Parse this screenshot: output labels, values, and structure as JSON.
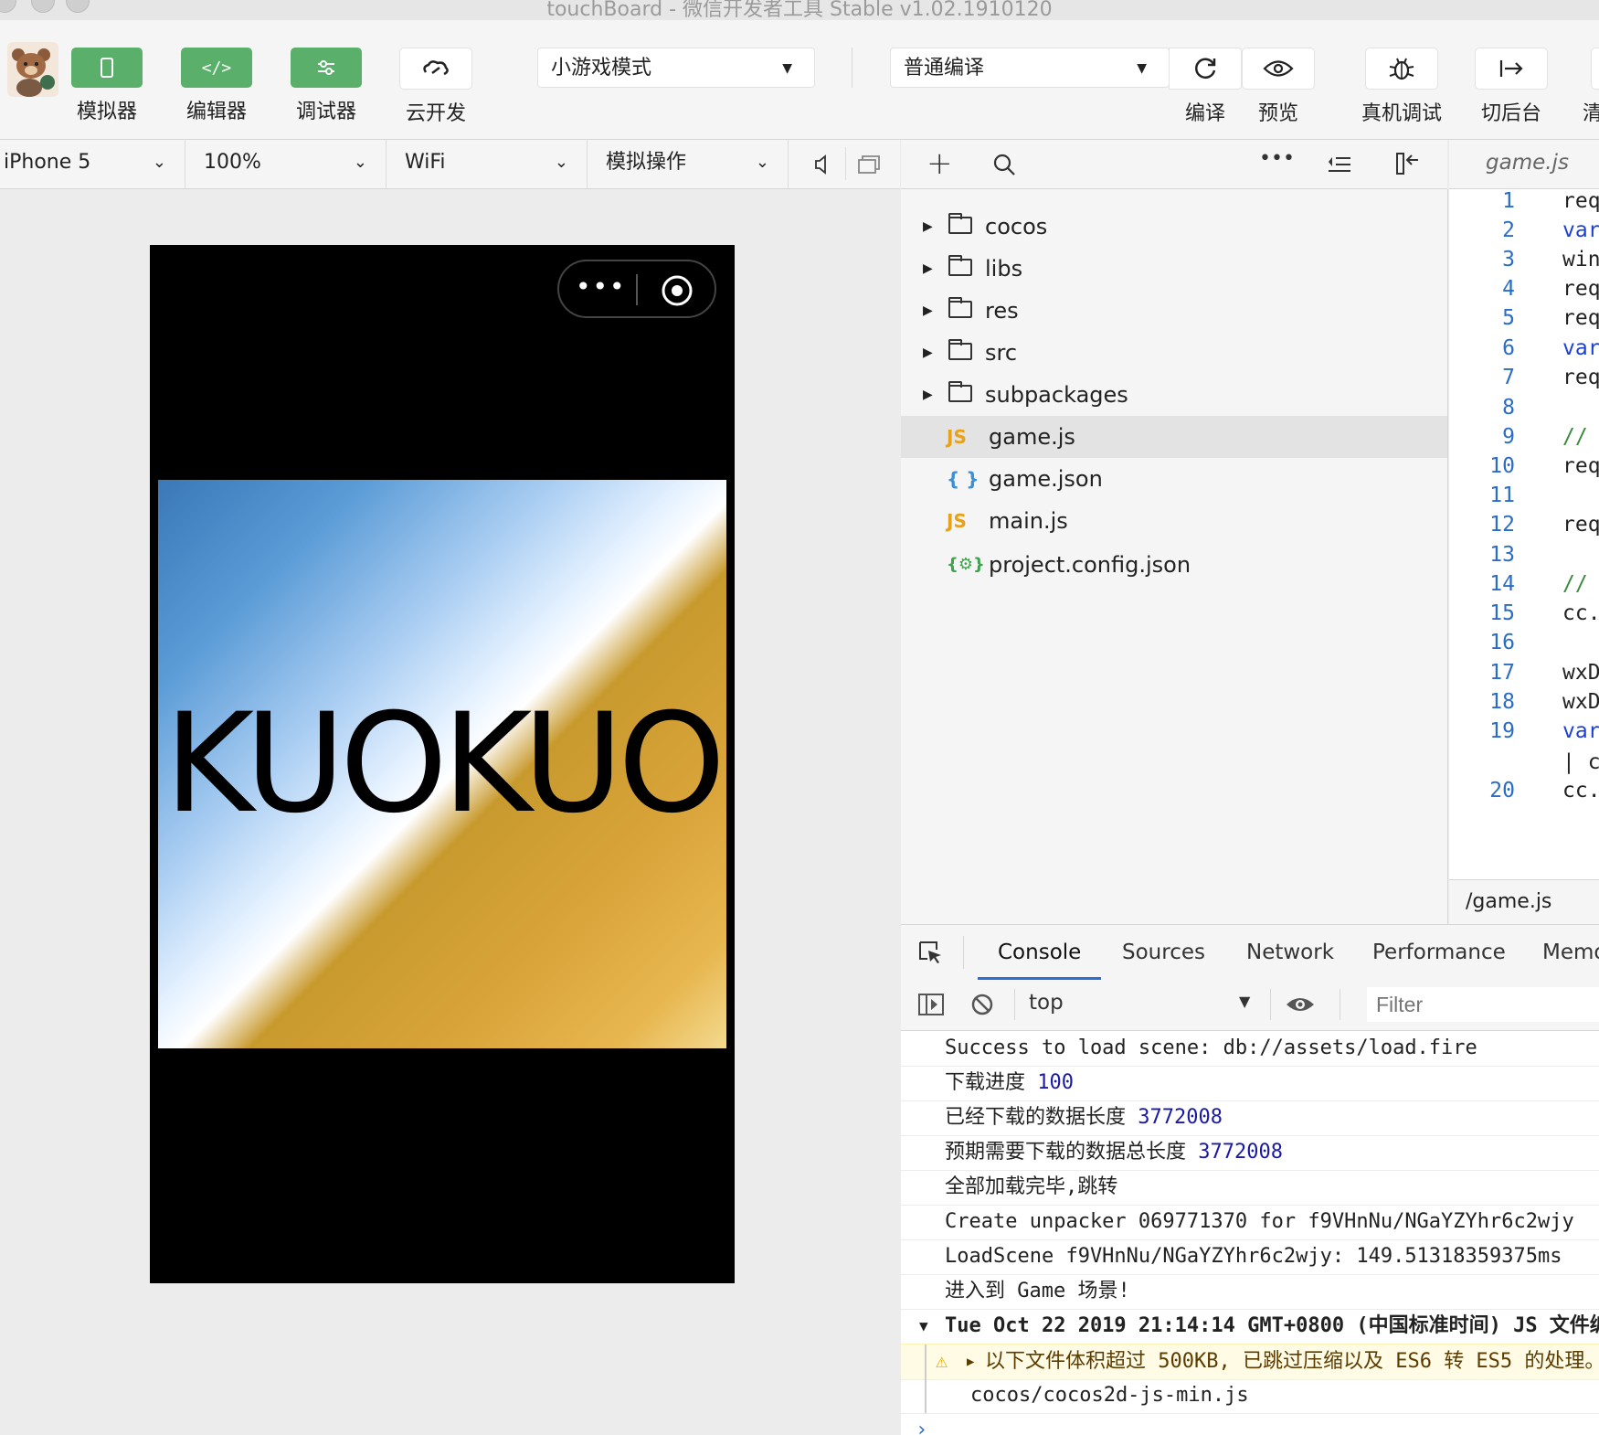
{
  "window": {
    "title": "touchBoard - 微信开发者工具 Stable v1.02.1910120"
  },
  "toolbar": {
    "simulator_label": "模拟器",
    "editor_label": "编辑器",
    "debugger_label": "调试器",
    "cloud_label": "云开发",
    "mode_select": "小游戏模式",
    "compile_select": "普通编译",
    "compile_label": "编译",
    "preview_label": "预览",
    "remote_debug_label": "真机调试",
    "background_label": "切后台",
    "cut_label": "清"
  },
  "device_bar": {
    "device": "iPhone 5",
    "zoom": "100%",
    "network": "WiFi",
    "operation": "模拟操作"
  },
  "game": {
    "title_text": "KUOKUO"
  },
  "file_tree": [
    {
      "name": "cocos",
      "type": "folder"
    },
    {
      "name": "libs",
      "type": "folder"
    },
    {
      "name": "res",
      "type": "folder"
    },
    {
      "name": "src",
      "type": "folder"
    },
    {
      "name": "subpackages",
      "type": "folder"
    },
    {
      "name": "game.js",
      "type": "js",
      "icon": "JS",
      "selected": true
    },
    {
      "name": "game.json",
      "type": "json",
      "icon": "{ }"
    },
    {
      "name": "main.js",
      "type": "js",
      "icon": "JS"
    },
    {
      "name": "project.config.json",
      "type": "config",
      "icon": "{⚙}"
    }
  ],
  "editor": {
    "tab": "game.js",
    "status_path": "/game.js",
    "lines": [
      {
        "n": "1",
        "code": "req",
        "kind": "plain"
      },
      {
        "n": "2",
        "code": "var",
        "kind": "kw"
      },
      {
        "n": "3",
        "code": "win",
        "kind": "plain"
      },
      {
        "n": "4",
        "code": "req",
        "kind": "plain"
      },
      {
        "n": "5",
        "code": "req",
        "kind": "plain"
      },
      {
        "n": "6",
        "code": "var",
        "kind": "kw"
      },
      {
        "n": "7",
        "code": "req",
        "kind": "plain"
      },
      {
        "n": "8",
        "code": "",
        "kind": "plain"
      },
      {
        "n": "9",
        "code": "//",
        "kind": "cm"
      },
      {
        "n": "10",
        "code": "req",
        "kind": "plain"
      },
      {
        "n": "11",
        "code": "",
        "kind": "plain"
      },
      {
        "n": "12",
        "code": "req",
        "kind": "plain"
      },
      {
        "n": "13",
        "code": "",
        "kind": "plain"
      },
      {
        "n": "14",
        "code": "//",
        "kind": "cm"
      },
      {
        "n": "15",
        "code": "cc.",
        "kind": "plain"
      },
      {
        "n": "16",
        "code": "",
        "kind": "plain"
      },
      {
        "n": "17",
        "code": "wxD",
        "kind": "plain"
      },
      {
        "n": "18",
        "code": "wxD",
        "kind": "plain"
      },
      {
        "n": "19",
        "code": "var",
        "kind": "kw"
      },
      {
        "n": "",
        "code": "| c",
        "kind": "plain"
      },
      {
        "n": "20",
        "code": "cc.",
        "kind": "plain"
      }
    ]
  },
  "devtools": {
    "tabs": [
      "Console",
      "Sources",
      "Network",
      "Performance",
      "Memo"
    ],
    "active_tab": "Console",
    "context": "top",
    "filter_placeholder": "Filter",
    "console_lines": [
      {
        "text": "Success to load scene: db://assets/load.fire",
        "value": ""
      },
      {
        "text": "下载进度",
        "value": "100"
      },
      {
        "text": "已经下载的数据长度",
        "value": "3772008"
      },
      {
        "text": "预期需要下载的数据总长度",
        "value": "3772008"
      },
      {
        "text": "全部加载完毕,跳转",
        "value": ""
      },
      {
        "text": "Create unpacker 069771370 for f9VHnNu/NGaYZYhr6c2wjy",
        "value": ""
      },
      {
        "text": "LoadScene f9VHnNu/NGaYZYhr6c2wjy: 149.51318359375ms",
        "value": ""
      },
      {
        "text": "进入到 Game 场景!",
        "value": ""
      }
    ],
    "group_header": "Tue Oct 22 2019 21:14:14 GMT+0800 (中国标准时间) JS 文件编",
    "warning": "以下文件体积超过 500KB, 已跳过压缩以及 ES6 转 ES5 的处理。",
    "warning_file": "cocos/cocos2d-js-min.js",
    "prompt": "›"
  },
  "colors": {
    "accent_green": "#5ab06b",
    "link_blue": "#2b6cd0",
    "number_blue": "#1a1aa6"
  }
}
